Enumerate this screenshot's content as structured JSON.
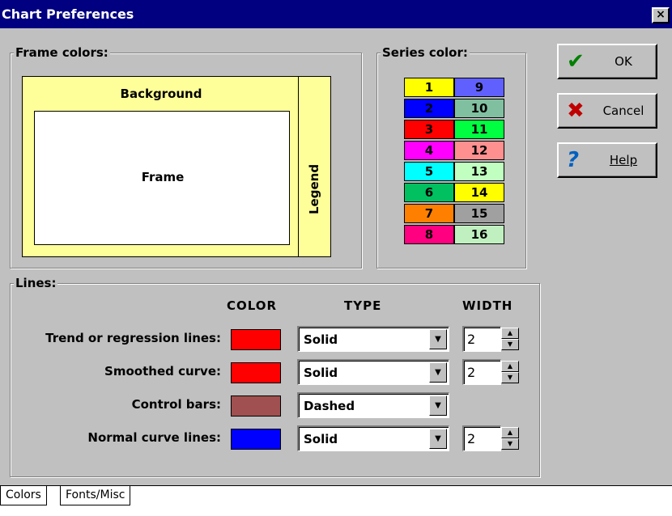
{
  "window": {
    "title": "Chart Preferences",
    "close_glyph": "×"
  },
  "frame_colors": {
    "label": "Frame colors:",
    "background_label": "Background",
    "frame_label": "Frame",
    "legend_label": "Legend",
    "colors": {
      "background": "#ffff99",
      "frame": "#ffffff",
      "legend": "#ffff99"
    }
  },
  "series_color": {
    "label": "Series color:",
    "swatches": [
      {
        "num": "1",
        "color": "#ffff00"
      },
      {
        "num": "2",
        "color": "#0000ff"
      },
      {
        "num": "3",
        "color": "#ff0000"
      },
      {
        "num": "4",
        "color": "#ff00ff"
      },
      {
        "num": "5",
        "color": "#00ffff"
      },
      {
        "num": "6",
        "color": "#00c060"
      },
      {
        "num": "7",
        "color": "#ff8000"
      },
      {
        "num": "8",
        "color": "#ff0080"
      },
      {
        "num": "9",
        "color": "#6060ff"
      },
      {
        "num": "10",
        "color": "#80c0a0"
      },
      {
        "num": "11",
        "color": "#00ff40"
      },
      {
        "num": "12",
        "color": "#ff9090"
      },
      {
        "num": "13",
        "color": "#c0ffc0"
      },
      {
        "num": "14",
        "color": "#ffff00"
      },
      {
        "num": "15",
        "color": "#a0a0a0"
      },
      {
        "num": "16",
        "color": "#c0f0c0"
      }
    ]
  },
  "buttons": {
    "ok": "OK",
    "cancel": "Cancel",
    "help": "Help"
  },
  "icons": {
    "ok": "checkmark-icon",
    "cancel": "x-icon",
    "help": "question-mark-icon"
  },
  "lines": {
    "label": "Lines:",
    "headers": {
      "color": "COLOR",
      "type": "TYPE",
      "width": "WIDTH"
    },
    "rows": [
      {
        "label": "Trend or regression lines:",
        "color": "#ff0000",
        "type": "Solid",
        "width": "2"
      },
      {
        "label": "Smoothed curve:",
        "color": "#ff0000",
        "type": "Solid",
        "width": "2"
      },
      {
        "label": "Control bars:",
        "color": "#a05050",
        "type": "Dashed",
        "width": null
      },
      {
        "label": "Normal curve lines:",
        "color": "#0000ff",
        "type": "Solid",
        "width": "2"
      }
    ]
  },
  "tabs": [
    {
      "label": "Colors",
      "active": true
    },
    {
      "label": "Fonts/Misc",
      "active": false
    }
  ]
}
